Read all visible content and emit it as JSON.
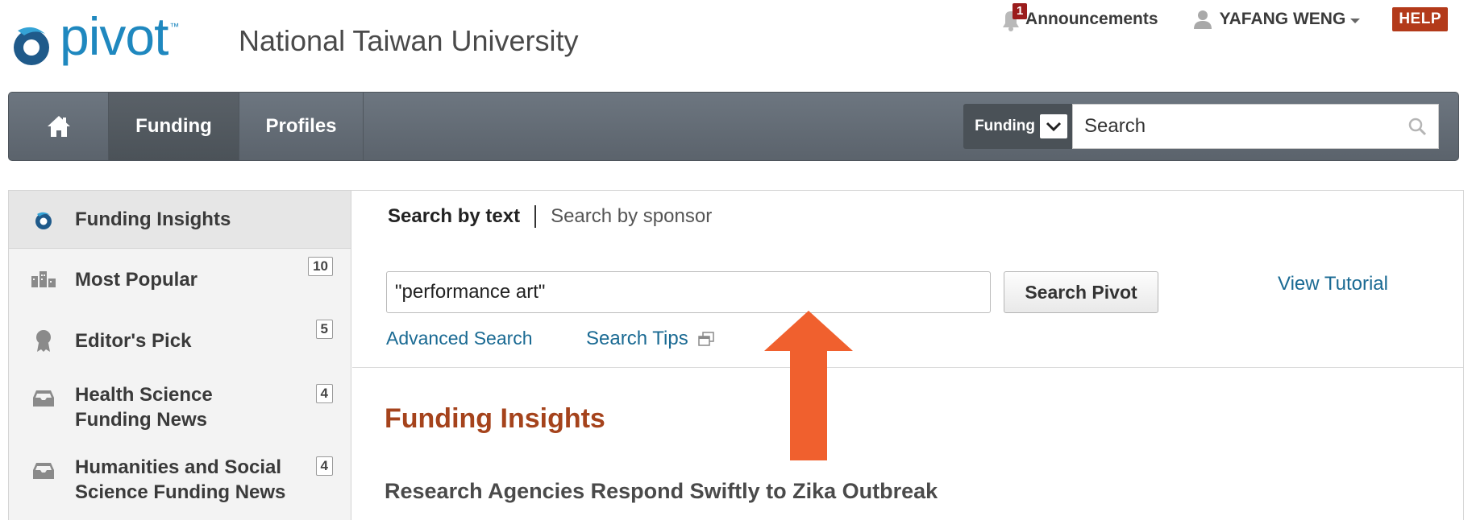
{
  "header": {
    "logo_text": "pivot",
    "logo_tm": "™",
    "institution": "National Taiwan University",
    "announcements_label": "Announcements",
    "announcements_count": "1",
    "user_name": "YAFANG WENG",
    "help_label": "HELP"
  },
  "nav": {
    "home_icon": "home-icon",
    "tabs": [
      "Funding",
      "Profiles"
    ],
    "search_scope": "Funding",
    "search_placeholder": "Search"
  },
  "sidebar": {
    "items": [
      {
        "label": "Funding Insights",
        "icon": "pivot-logo-icon"
      },
      {
        "label": "Most Popular",
        "count": "10",
        "icon": "buildings-icon"
      },
      {
        "label": "Editor's Pick",
        "count": "5",
        "icon": "ribbon-award-icon"
      },
      {
        "label": "Health Science Funding News",
        "count": "4",
        "icon": "inbox-tray-icon"
      },
      {
        "label": "Humanities and Social Science Funding News",
        "count": "4",
        "icon": "inbox-tray-icon"
      }
    ]
  },
  "search": {
    "tab_active": "Search by text",
    "tab_inactive": "Search by sponsor",
    "query_value": "\"performance art\"",
    "button_label": "Search Pivot",
    "tutorial_link": "View Tutorial",
    "advanced_link": "Advanced Search",
    "tips_link": "Search Tips"
  },
  "insights": {
    "title": "Funding Insights",
    "article_title": "Research Agencies Respond Swiftly to Zika Outbreak"
  },
  "colors": {
    "brand_blue": "#1f88bf",
    "nav_gray": "#626a73",
    "help_red": "#b33a1a",
    "insights_orange": "#a5431c",
    "link_blue": "#1a6a93",
    "annotation_arrow": "#f0602e"
  }
}
